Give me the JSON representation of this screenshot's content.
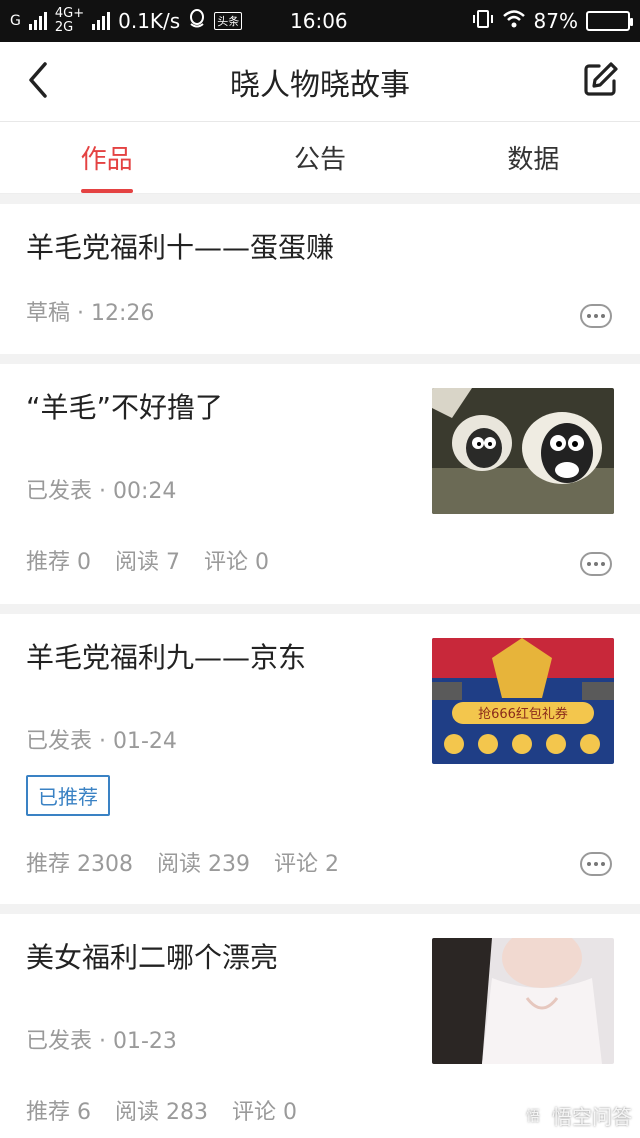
{
  "status_bar": {
    "net1": "G",
    "net2_top": "4G+",
    "net2_bottom": "2G",
    "speed": "0.1K/s",
    "app_badge": "头条",
    "time": "16:06",
    "battery": "87%",
    "battery_level": 0.87
  },
  "header": {
    "title": "晓人物晓故事",
    "back_icon": "chevron-left-icon",
    "edit_icon": "edit-icon"
  },
  "tabs": [
    {
      "label": "作品",
      "active": true
    },
    {
      "label": "公告",
      "active": false
    },
    {
      "label": "数据",
      "active": false
    }
  ],
  "articles": [
    {
      "title": "羊毛党福利十——蛋蛋赚",
      "meta": "草稿 · 12:26"
    },
    {
      "title": "“羊毛”不好撸了",
      "meta": "已发表 · 00:24",
      "stats": [
        "推荐 0",
        "阅读 7",
        "评论 0"
      ],
      "thumb": "sheep"
    },
    {
      "title": "羊毛党福利九——京东",
      "meta": "已发表 · 01-24",
      "badge": "已推荐",
      "stats": [
        "推荐 2308",
        "阅读 239",
        "评论 2"
      ],
      "thumb": "redpacket",
      "thumb_text": "抢666红包礼券"
    },
    {
      "title": "美女福利二哪个漂亮",
      "meta": "已发表 · 01-23",
      "stats": [
        "推荐 6",
        "阅读 283",
        "评论 0"
      ],
      "thumb": "portrait"
    }
  ],
  "watermark": "悟空问答",
  "colors": {
    "accent": "#e44242",
    "badge": "#3a82c4"
  }
}
